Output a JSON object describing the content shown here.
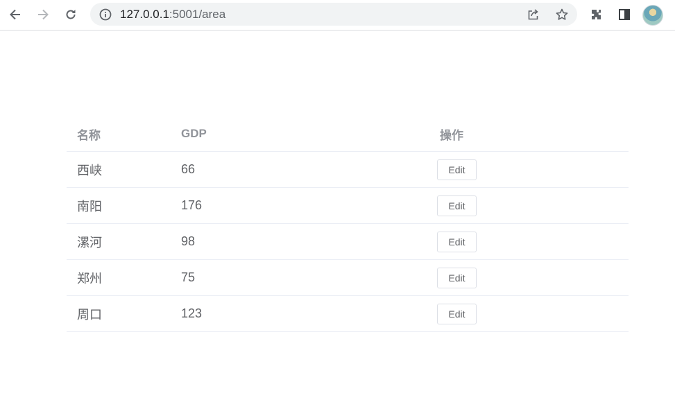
{
  "browser": {
    "url_host": "127.0.0.1",
    "url_rest": ":5001/area",
    "icons": [
      "back-icon",
      "forward-icon",
      "reload-icon",
      "info-icon",
      "share-icon",
      "star-icon",
      "extensions-icon",
      "side-panel-icon",
      "profile-avatar"
    ]
  },
  "table": {
    "headers": {
      "name": "名称",
      "gdp": "GDP",
      "action": "操作"
    },
    "rows": [
      {
        "name": "西峡",
        "gdp": "66",
        "action": "Edit"
      },
      {
        "name": "南阳",
        "gdp": "176",
        "action": "Edit"
      },
      {
        "name": "漯河",
        "gdp": "98",
        "action": "Edit"
      },
      {
        "name": "郑州",
        "gdp": "75",
        "action": "Edit"
      },
      {
        "name": "周口",
        "gdp": "123",
        "action": "Edit"
      }
    ]
  },
  "colors": {
    "header_text": "#909399",
    "cell_text": "#606266",
    "row_border": "#ebeef5",
    "button_border": "#dcdfe6"
  }
}
